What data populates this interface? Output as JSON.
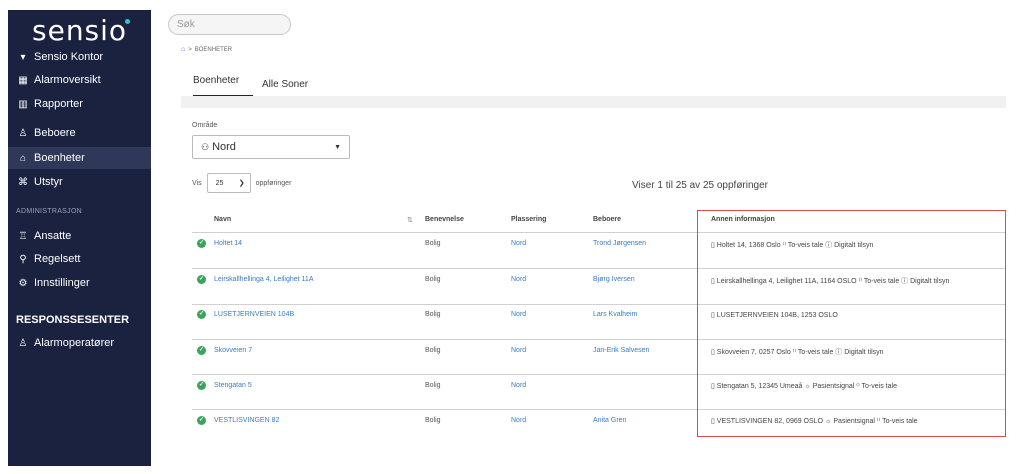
{
  "brand": {
    "logo": "sensio"
  },
  "sidebar": {
    "org": "Sensio Kontor",
    "items": [
      {
        "label": "Alarmoversikt",
        "icon": "grid-icon"
      },
      {
        "label": "Rapporter",
        "icon": "chart-icon"
      },
      {
        "label": "Beboere",
        "icon": "user-icon"
      },
      {
        "label": "Boenheter",
        "icon": "home-icon"
      },
      {
        "label": "Utstyr",
        "icon": "devices-icon"
      }
    ],
    "section_admin": "ADMINISTRASJON",
    "admin_items": [
      {
        "label": "Ansatte",
        "icon": "staff-icon"
      },
      {
        "label": "Regelsett",
        "icon": "rules-icon"
      },
      {
        "label": "Innstillinger",
        "icon": "gear-icon"
      }
    ],
    "section_response": "RESPONSSESENTER",
    "response_items": [
      {
        "label": "Alarmoperatører",
        "icon": "operator-icon"
      }
    ]
  },
  "search": {
    "placeholder": "Søk"
  },
  "breadcrumb": {
    "current": "BOENHETER"
  },
  "tabs": [
    "Boenheter",
    "Alle Soner"
  ],
  "filter": {
    "area_label": "Område",
    "area_value": "Nord",
    "show_label": "Vis",
    "show_value": "25",
    "show_suffix": "oppføringer",
    "summary": "Viser 1 til 25 av 25 oppføringer"
  },
  "table": {
    "columns": [
      "Navn",
      "Benevnelse",
      "Plassering",
      "Beboere",
      "Annen informasjon"
    ],
    "rows": [
      {
        "navn": "Holtet 14",
        "benevnelse": "Bolig",
        "plassering": "Nord",
        "beboere": "Trond Jørgensen",
        "info": "Holtet 14, 1368 Oslo ⁽⁾ To-veis tale ⓘ Digitalt tilsyn"
      },
      {
        "navn": "Leirskallhellinga 4, Leilighet 11A",
        "benevnelse": "Bolig",
        "plassering": "Nord",
        "beboere": "Bjørg Iversen",
        "info": "Leirskallhellinga 4, Leilighet 11A, 1164 OSLO ⁽⁾ To-veis tale ⓘ Digitalt tilsyn"
      },
      {
        "navn": "LUSETJERNVEIEN 104B",
        "benevnelse": "Bolig",
        "plassering": "Nord",
        "beboere": "Lars Kvalheim",
        "info": "LUSETJERNVEIEN 104B, 1253 OSLO"
      },
      {
        "navn": "Skovveien 7",
        "benevnelse": "Bolig",
        "plassering": "Nord",
        "beboere": "Jan-Erik Salvesen",
        "info": "Skovveien 7, 0257 Oslo ⁽⁾ To-veis tale ⓘ Digitalt tilsyn"
      },
      {
        "navn": "Stengatan 5",
        "benevnelse": "Bolig",
        "plassering": "Nord",
        "beboere": "",
        "info": "Stengatan 5, 12345 Umeaå ☼ Pasientsignal ⁽⁾ To-veis tale"
      },
      {
        "navn": "VESTLISVINGEN 82",
        "benevnelse": "Bolig",
        "plassering": "Nord",
        "beboere": "Anita Gren",
        "info": "VESTLISVINGEN 82, 0969 OSLO ☼ Pasientsignal ⁽⁾ To-veis tale"
      }
    ]
  },
  "colors": {
    "sidebar": "#1b2240",
    "link": "#3a7bc8",
    "ok": "#3aa55a",
    "highlight": "#d94b4b"
  }
}
